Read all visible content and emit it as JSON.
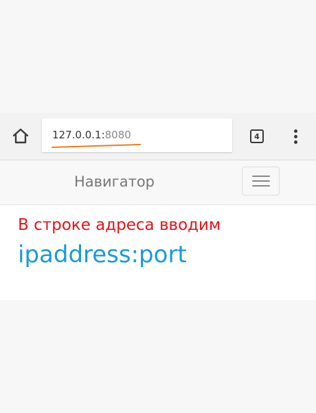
{
  "browser": {
    "url_host": "127.0.0.1:",
    "url_port": "8080",
    "tab_count": "4",
    "underline_color": "#f07c1a"
  },
  "navbar": {
    "brand": "Навигатор"
  },
  "content": {
    "instruction": "В строке адреса вводим",
    "address_format": "ipaddress:port"
  },
  "icons": {
    "home": "home-icon",
    "tabs": "tab-switcher-icon",
    "menu": "overflow-menu-icon",
    "toggle": "hamburger-menu-icon"
  },
  "colors": {
    "instruction": "#e0141c",
    "address_format": "#1a9bd7"
  }
}
